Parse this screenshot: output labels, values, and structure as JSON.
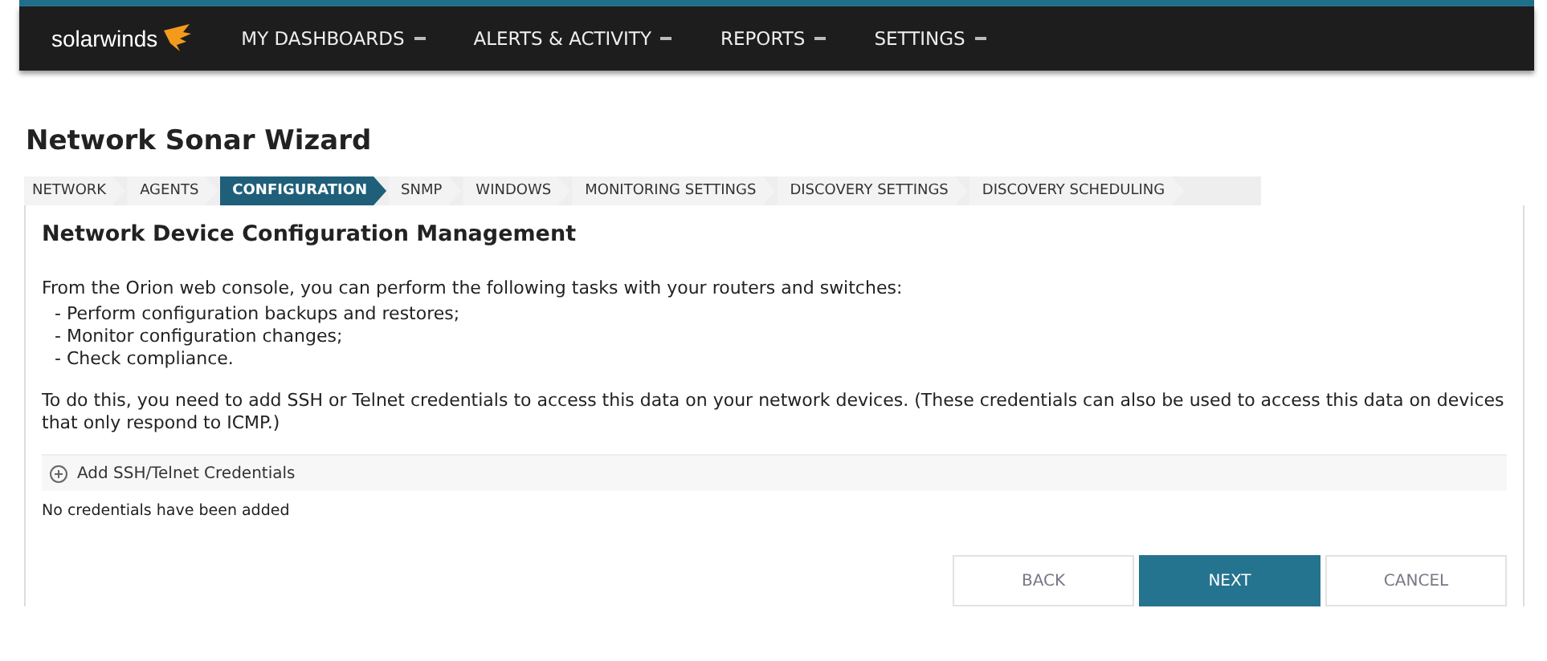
{
  "nav": {
    "logo": "solarwinds",
    "items": [
      {
        "label": "MY DASHBOARDS"
      },
      {
        "label": "ALERTS & ACTIVITY"
      },
      {
        "label": "REPORTS"
      },
      {
        "label": "SETTINGS"
      }
    ]
  },
  "page_title": "Network Sonar Wizard",
  "steps": [
    {
      "label": "NETWORK",
      "selected": false
    },
    {
      "label": "AGENTS",
      "selected": false
    },
    {
      "label": "CONFIGURATION",
      "selected": true
    },
    {
      "label": "SNMP",
      "selected": false
    },
    {
      "label": "WINDOWS",
      "selected": false
    },
    {
      "label": "MONITORING SETTINGS",
      "selected": false
    },
    {
      "label": "DISCOVERY SETTINGS",
      "selected": false
    },
    {
      "label": "DISCOVERY SCHEDULING",
      "selected": false
    }
  ],
  "section_title": "Network Device Configuration Management",
  "intro": "From the Orion web console, you can perform the following tasks with your routers and switches:",
  "tasks": [
    "- Perform configuration backups and restores;",
    "- Monitor configuration changes;",
    "- Check compliance."
  ],
  "note": "To do this, you need to add SSH or Telnet credentials to access this data on your network devices. (These credentials can also be used to access this data on devices that only respond to ICMP.)",
  "add_credentials": "Add SSH/Telnet Credentials",
  "empty_message": "No credentials have been added",
  "buttons": [
    {
      "label": "BACK",
      "kind": "secondary"
    },
    {
      "label": "NEXT",
      "kind": "primary"
    },
    {
      "label": "CANCEL",
      "kind": "secondary"
    }
  ]
}
